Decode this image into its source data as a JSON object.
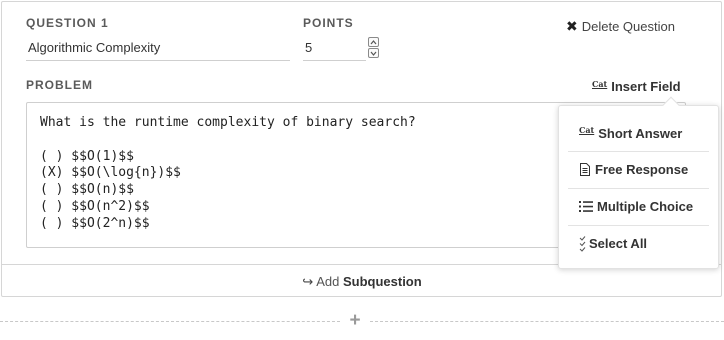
{
  "question": {
    "label": "QUESTION 1",
    "value": "Algorithmic Complexity"
  },
  "points": {
    "label": "POINTS",
    "value": "5"
  },
  "delete_label": "Delete Question",
  "problem": {
    "label": "PROBLEM",
    "text": "What is the runtime complexity of binary search?\n\n( ) $$O(1)$$\n(X) $$O(\\log{n})$$\n( ) $$O(n)$$\n( ) $$O(n^2)$$\n( ) $$O(2^n)$$"
  },
  "insert_field": {
    "icon_text": "Cat",
    "label": "Insert Field",
    "menu": [
      {
        "icon": "short-answer-icon",
        "icon_text": "Cat",
        "label": "Short Answer"
      },
      {
        "icon": "document-icon",
        "label": "Free Response"
      },
      {
        "icon": "list-icon",
        "label": "Multiple Choice"
      },
      {
        "icon": "select-all-icon",
        "label": "Select All"
      }
    ]
  },
  "add_subquestion": {
    "prefix": "Add",
    "bold": "Subquestion"
  }
}
